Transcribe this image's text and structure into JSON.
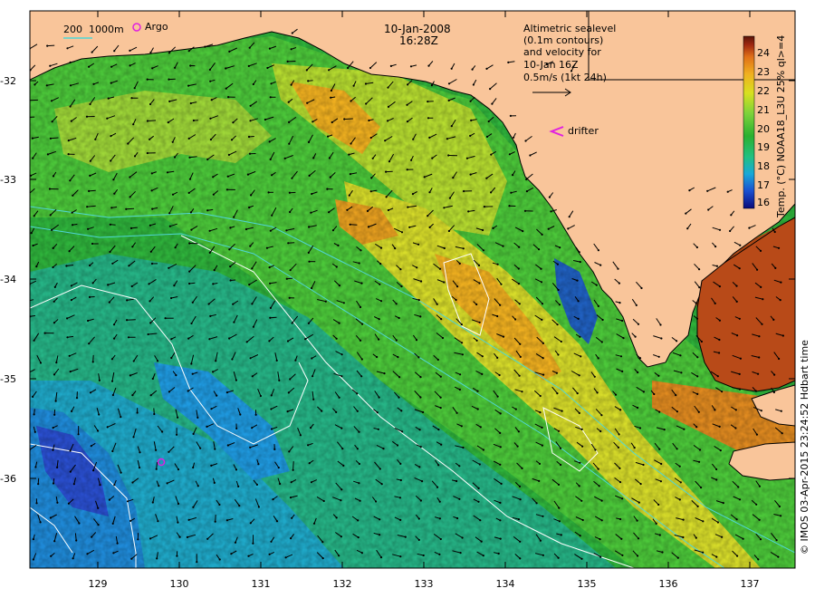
{
  "title": {
    "date": "10-Jan-2008",
    "time": "16:28Z"
  },
  "legend": {
    "isobath": "200  1000m",
    "argo": "Argo",
    "altimetry_lines": [
      "Altimetric sealevel",
      "(0.1m contours)",
      "and velocity for",
      "10-Jan 16Z",
      "0.5m/s (1kt 24h)"
    ],
    "drifter": "drifter"
  },
  "axes": {
    "y_ticks": [
      "-32",
      "-33",
      "-34",
      "-35",
      "-36"
    ],
    "x_ticks": [
      "129",
      "130",
      "131",
      "132",
      "133",
      "134",
      "135",
      "136",
      "137"
    ]
  },
  "colorbar": {
    "ticks": [
      "24",
      "23",
      "22",
      "21",
      "20",
      "19",
      "18",
      "17",
      "16"
    ],
    "label": "Temp. (°C) NOAA18_L3U 25% ql>=4",
    "colors": [
      "#0a0a7a",
      "#1a4fd0",
      "#19a8d8",
      "#22c080",
      "#2ab030",
      "#7cd23a",
      "#d8e020",
      "#f0b020",
      "#e07018",
      "#a02810",
      "#5a1408"
    ]
  },
  "credit": "© IMOS 03-Apr-2015 23:24:52 Hdbart time",
  "colors": {
    "land": "#f9c59a",
    "ocean_green": "#3cbf3c",
    "ocean_blue": "#2a9fd0",
    "warm": "#f0a020",
    "hot": "#b03810",
    "isobath": "#4fd6d6",
    "contour": "#ffffff",
    "argo": "#e020e0",
    "arrow": "#000000"
  }
}
